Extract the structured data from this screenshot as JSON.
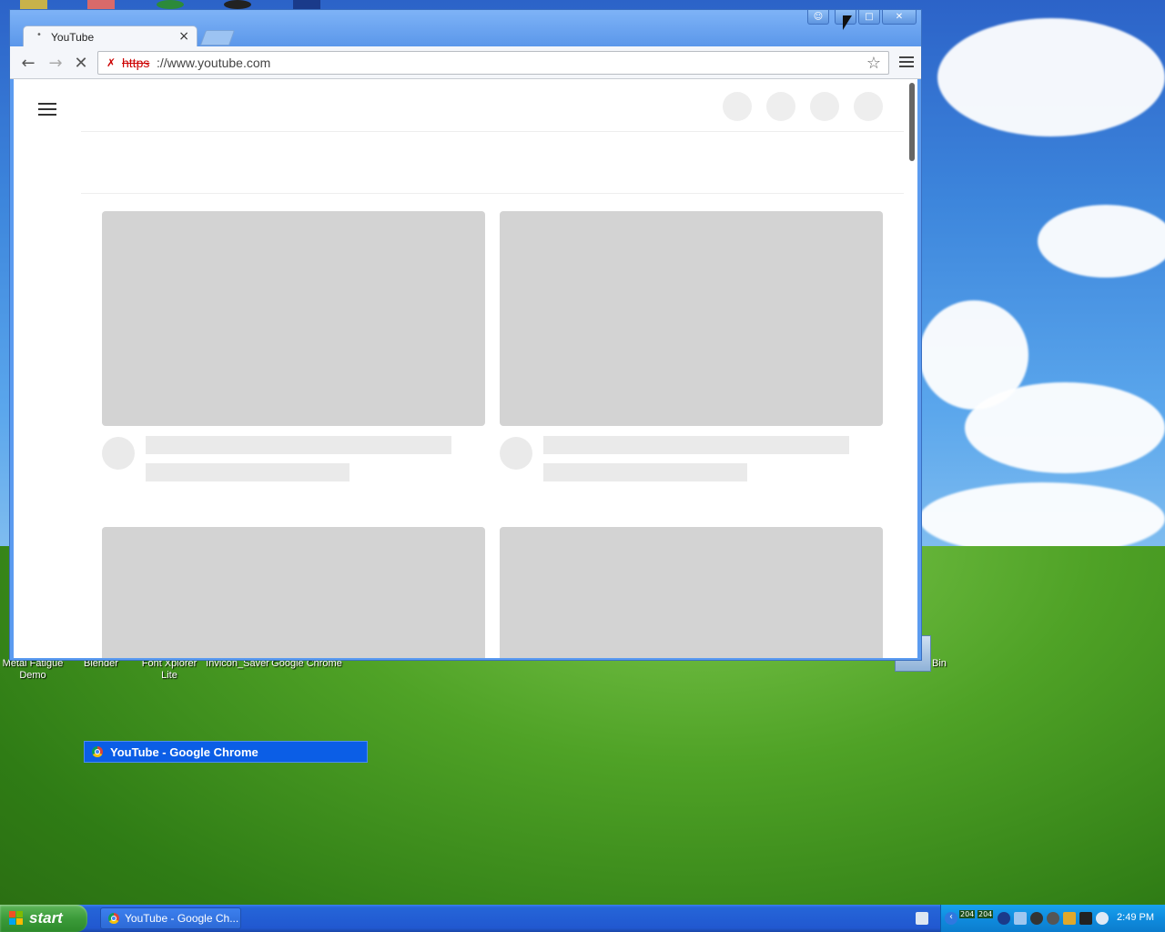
{
  "desktop": {
    "icons": [
      {
        "label": "Metal Fatigue Demo",
        "icon": "app-icon"
      },
      {
        "label": "Blender",
        "icon": "blender-icon"
      },
      {
        "label": "Font Xplorer Lite",
        "icon": "font-icon"
      },
      {
        "label": "Invicon_Saver",
        "icon": "saver-icon"
      },
      {
        "label": "Google Chrome",
        "icon": "chrome-icon"
      }
    ],
    "recycle_bin_label": "Bin"
  },
  "window": {
    "tab_title": "YouTube",
    "url_scheme": "https",
    "url_rest": "://www.youtube.com",
    "caption_icons": [
      "profile-icon",
      "minimize-icon",
      "maximize-icon",
      "close-icon"
    ]
  },
  "switcher": {
    "label": "YouTube - Google Chrome"
  },
  "taskbar": {
    "start_label": "start",
    "task_label": "YouTube - Google Ch...",
    "clock": "2:49 PM",
    "counters": [
      "204",
      "204"
    ]
  },
  "colors": {
    "taskbar_blue": "#2158d0",
    "start_green": "#3c9b3a",
    "switcher_blue": "#0b5ee6",
    "placeholder_gray": "#d3d3d3"
  }
}
